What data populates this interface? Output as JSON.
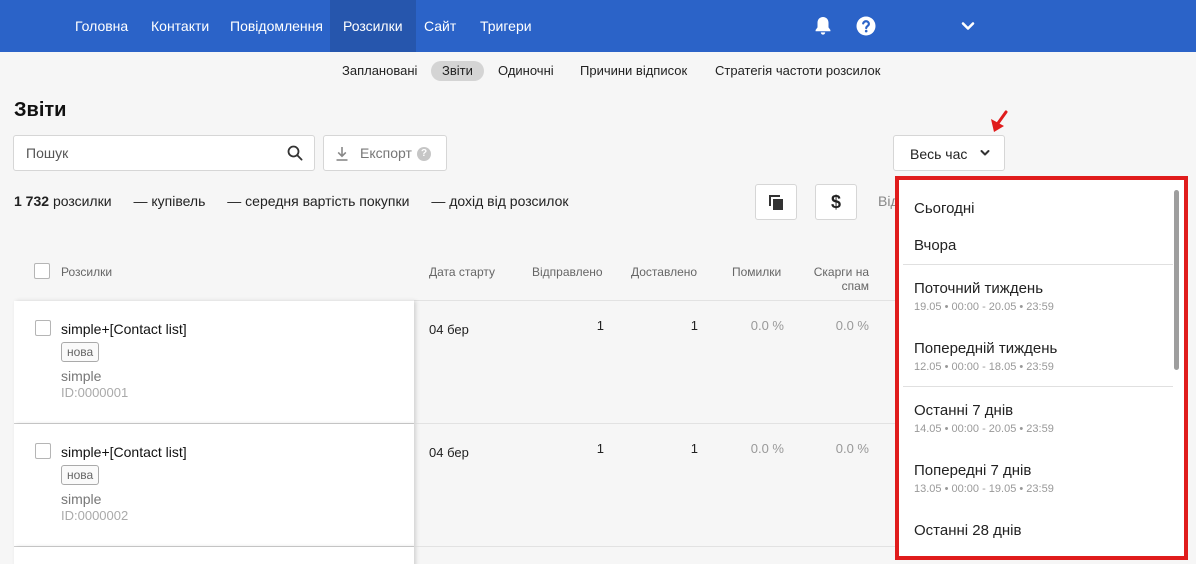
{
  "nav": {
    "items": [
      "Головна",
      "Контакти",
      "Повідомлення",
      "Розсилки",
      "Сайт",
      "Тригери"
    ],
    "active_index": 3
  },
  "subtabs": {
    "items": [
      "Заплановані",
      "Звіти",
      "Одиночні",
      "Причини відписок",
      "Стратегія частоти розсилок"
    ],
    "active_index": 1
  },
  "page_title": "Звіти",
  "search": {
    "placeholder": "Пошук",
    "value": ""
  },
  "export": {
    "label": "Експорт",
    "help": "?"
  },
  "period": {
    "label": "Весь час"
  },
  "stats": {
    "count": "1 732",
    "count_label": "розсилки",
    "purchases": "— купівель",
    "avg": "— середня вартість покупки",
    "revenue": "— дохід від розсилок"
  },
  "toolbar": {
    "currency": "$",
    "cut_text": "Від"
  },
  "table": {
    "headers": {
      "name": "Розсилки",
      "start": "Дата старту",
      "sent": "Відправлено",
      "delivered": "Доставлено",
      "errors": "Помилки",
      "spam_line1": "Скарги на",
      "spam_line2": "спам"
    },
    "rows": [
      {
        "name": "simple+[Contact list]",
        "badge": "нова",
        "type": "simple",
        "id": "ID:0000001",
        "start": "04 бер",
        "sent": "1",
        "delivered": "1",
        "errors": "0.0 %",
        "spam": "0.0 %"
      },
      {
        "name": "simple+[Contact list]",
        "badge": "нова",
        "type": "simple",
        "id": "ID:0000002",
        "start": "04 бер",
        "sent": "1",
        "delivered": "1",
        "errors": "0.0 %",
        "spam": "0.0 %"
      }
    ]
  },
  "dropdown": {
    "items": [
      {
        "label": "Сьогодні",
        "sub": ""
      },
      {
        "label": "Вчора",
        "sub": ""
      },
      {
        "label": "Поточний тиждень",
        "sub": "19.05 • 00:00 - 20.05 • 23:59"
      },
      {
        "label": "Попередній тиждень",
        "sub": "12.05 • 00:00 - 18.05 • 23:59"
      },
      {
        "label": "Останні 7 днів",
        "sub": "14.05 • 00:00 - 20.05 • 23:59"
      },
      {
        "label": "Попередні 7 днів",
        "sub": "13.05 • 00:00 - 19.05 • 23:59"
      },
      {
        "label": "Останні 28 днів",
        "sub": ""
      }
    ]
  },
  "colors": {
    "nav_bg": "#2b63c8",
    "highlight_border": "#e01c1c"
  }
}
